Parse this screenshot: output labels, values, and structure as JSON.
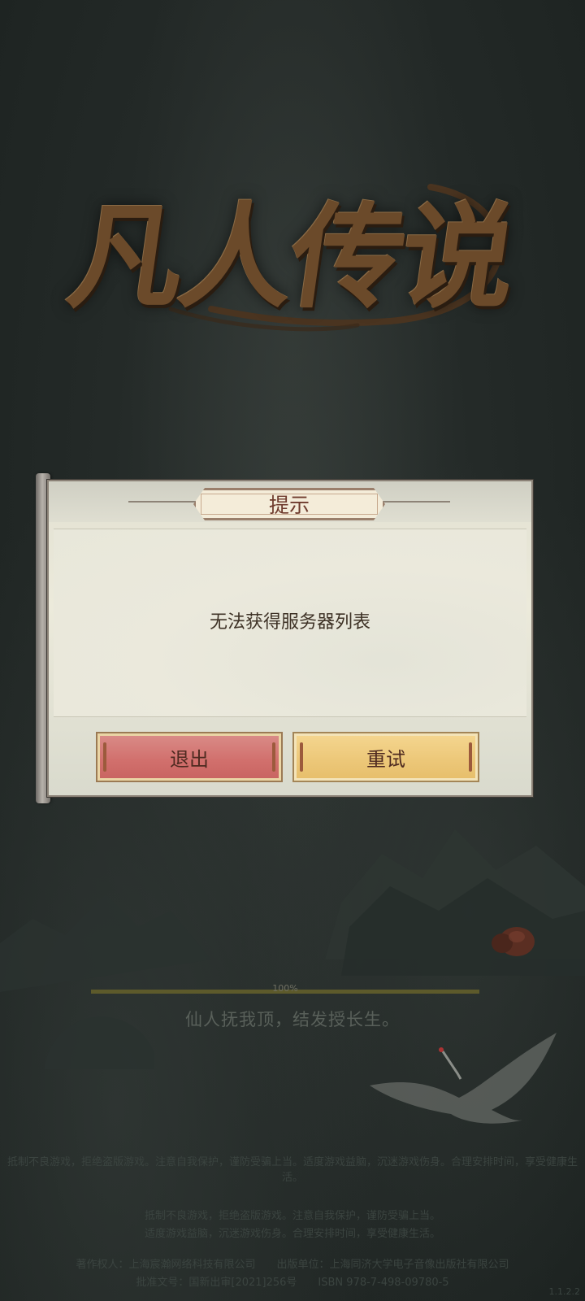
{
  "logo": {
    "text": "凡人传说"
  },
  "dialog": {
    "title": "提示",
    "message": "无法获得服务器列表",
    "buttons": {
      "exit": "退出",
      "retry": "重试"
    }
  },
  "loading": {
    "progress_label": "100%",
    "progress_fraction": 1.0,
    "tip": "仙人抚我顶，结发授长生。"
  },
  "footer": {
    "line1": "抵制不良游戏，拒绝盗版游戏。注意自我保护，谨防受骗上当。适度游戏益脑，沉迷游戏伤身。合理安排时间，享受健康生活。",
    "line2": "抵制不良游戏，拒绝盗版游戏。注意自我保护，谨防受骗上当。",
    "line3": "适度游戏益脑，沉迷游戏伤身。合理安排时间，享受健康生活。",
    "copyright": "著作权人：上海宸瀚网络科技有限公司　　出版单位：上海同济大学电子音像出版社有限公司",
    "approval": "批准文号：国新出审[2021]256号　　ISBN 978-7-498-09780-5",
    "version": "1.1.2.2"
  },
  "colors": {
    "background": "#242a28",
    "panel": "#eceadb",
    "exit_button": "#d16f6c",
    "retry_button": "#ecc778",
    "title_text": "#6e3a2c"
  }
}
